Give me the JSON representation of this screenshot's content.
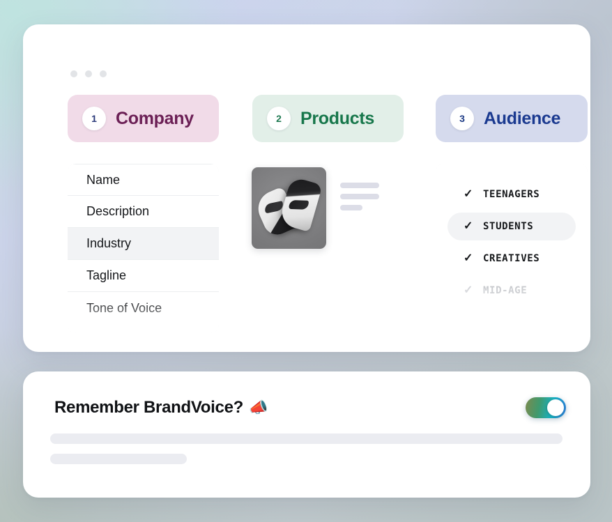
{
  "window": {
    "dots": [
      "dot-1",
      "dot-2",
      "dot-3"
    ]
  },
  "steps": [
    {
      "number": "1",
      "label": "Company",
      "pill_color": "#f1dbe8",
      "text_color": "#6b1f55"
    },
    {
      "number": "2",
      "label": "Products",
      "pill_color": "#e2efe8",
      "text_color": "#17774b"
    },
    {
      "number": "3",
      "label": "Audience",
      "pill_color": "#d5daed",
      "text_color": "#1b3a90"
    }
  ],
  "company_fields": [
    {
      "label": "Name",
      "active": false
    },
    {
      "label": "Description",
      "active": false
    },
    {
      "label": "Industry",
      "active": true
    },
    {
      "label": "Tagline",
      "active": false
    },
    {
      "label": "Tone of Voice",
      "active": false
    }
  ],
  "products": {
    "photo_alt": "sneakers-photo",
    "skeleton_widths": [
      "56px",
      "56px",
      "32px"
    ]
  },
  "audience": [
    {
      "label": "TEENAGERS",
      "check": "✓",
      "selected": false,
      "dim": false
    },
    {
      "label": "STUDENTS",
      "check": "✓",
      "selected": true,
      "dim": false
    },
    {
      "label": "CREATIVES",
      "check": "✓",
      "selected": false,
      "dim": false
    },
    {
      "label": "MID-AGE",
      "check": "✓",
      "selected": false,
      "dim": true
    }
  ],
  "brandvoice": {
    "title": "Remember BrandVoice?",
    "emoji": "📣",
    "toggle_state": "on",
    "skeleton_widths": [
      "735px",
      "196px"
    ]
  }
}
